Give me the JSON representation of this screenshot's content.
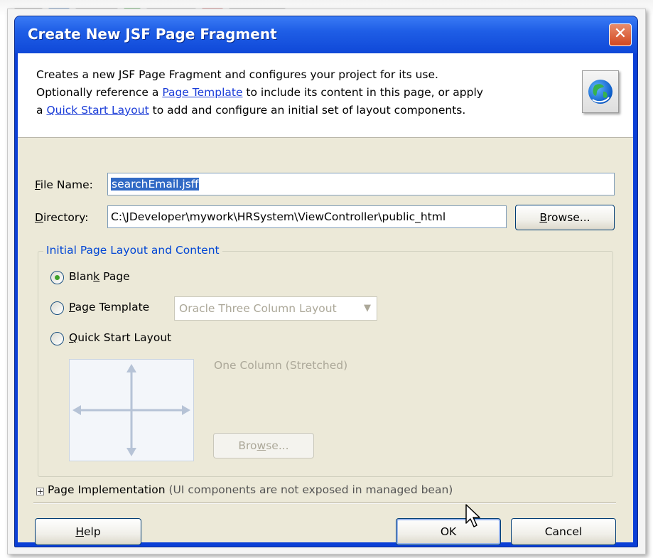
{
  "dialog": {
    "title": "Create New JSF Page Fragment",
    "close_glyph": "✕",
    "description": {
      "line1": "Creates a new JSF Page Fragment and configures your project for its use.",
      "line2_pre": "Optionally reference a ",
      "line2_link": "Page Template",
      "line2_post": " to include its content in this page, or apply",
      "line3_pre": "a ",
      "line3_link": "Quick Start Layout",
      "line3_post": " to add and configure an initial set of layout components."
    },
    "icon": "globe-icon"
  },
  "form": {
    "file_name_label_key": "F",
    "file_name_label_rest": "ile Name:",
    "file_name_value": "searchEmail.jsff",
    "directory_label_key": "D",
    "directory_label_rest": "irectory:",
    "directory_value": "C:\\JDeveloper\\mywork\\HRSystem\\ViewController\\public_html",
    "browse_pre": "",
    "browse_key": "B",
    "browse_post": "rowse..."
  },
  "layout_group": {
    "title": "Initial Page Layout and Content",
    "options": [
      {
        "label_pre": "Blan",
        "label_key": "k",
        "label_post": " Page",
        "selected": true
      },
      {
        "label_pre": "",
        "label_key": "P",
        "label_post": "age Template",
        "selected": false
      },
      {
        "label_pre": "",
        "label_key": "Q",
        "label_post": "uick Start Layout",
        "selected": false
      }
    ],
    "template_select_value": "Oracle Three Column Layout",
    "quick_layout_name": "One Column (Stretched)",
    "browse_disabled_pre": "Bro",
    "browse_disabled_key": "w",
    "browse_disabled_post": "se..."
  },
  "implementation": {
    "label": "Page Implementation",
    "note": " (UI components are not exposed in managed bean)",
    "expand_glyph": "+"
  },
  "buttons": {
    "help_key": "H",
    "help_rest": "elp",
    "ok": "OK",
    "cancel": "Cancel"
  }
}
